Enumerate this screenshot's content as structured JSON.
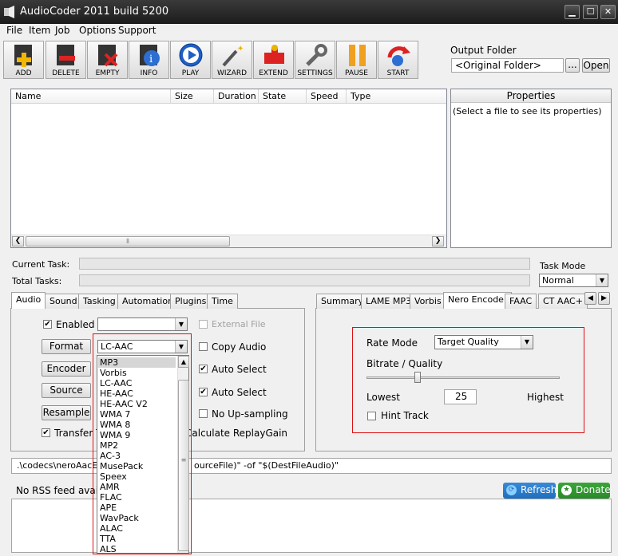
{
  "window": {
    "title": "AudioCoder 2011 build 5200",
    "minimize": "▁",
    "maximize": "☐",
    "close": "✕"
  },
  "menu": [
    "File",
    "Item",
    "Job",
    "Options",
    "Support"
  ],
  "toolbar": [
    {
      "label": "ADD",
      "icon": "add-icon"
    },
    {
      "label": "DELETE",
      "icon": "delete-icon"
    },
    {
      "label": "EMPTY",
      "icon": "empty-icon"
    },
    {
      "label": "INFO",
      "icon": "info-icon"
    },
    {
      "label": "PLAY",
      "icon": "play-icon"
    },
    {
      "label": "WIZARD",
      "icon": "wizard-icon"
    },
    {
      "label": "EXTEND",
      "icon": "extend-icon"
    },
    {
      "label": "SETTINGS",
      "icon": "settings-icon"
    },
    {
      "label": "PAUSE",
      "icon": "pause-icon"
    },
    {
      "label": "START",
      "icon": "start-icon"
    }
  ],
  "output": {
    "label": "Output Folder",
    "value": "<Original Folder>",
    "browse": "...",
    "open": "Open"
  },
  "filelist": {
    "columns": [
      "Name",
      "Size",
      "Duration",
      "State",
      "Speed",
      "Type"
    ]
  },
  "properties": {
    "header": "Properties",
    "placeholder": "(Select a file to see its properties)"
  },
  "progress": {
    "current_task": "Current Task:",
    "total_tasks": "Total Tasks:"
  },
  "task_mode": {
    "label": "Task Mode",
    "value": "Normal"
  },
  "left_tabs": [
    "Audio",
    "Sound",
    "Tasking",
    "Automation",
    "Plugins",
    "Time"
  ],
  "audio": {
    "enabled": "Enabled",
    "external_file": "External File",
    "format_btn": "Format",
    "format_value": "LC-AAC",
    "encoder_btn": "Encoder",
    "source_btn": "Source",
    "resample_btn": "Resample",
    "copy_audio": "Copy Audio",
    "auto_select_1": "Auto Select",
    "auto_select_2": "Auto Select",
    "no_upsampling": "No Up-sampling",
    "transfer_tags": "Transfer Ta",
    "replaygain": "Calculate ReplayGain"
  },
  "format_options": [
    "MP3",
    "Vorbis",
    "LC-AAC",
    "HE-AAC",
    "HE-AAC V2",
    "WMA 7",
    "WMA 8",
    "WMA 9",
    "MP2",
    "AC-3",
    "MusePack",
    "Speex",
    "AMR",
    "FLAC",
    "APE",
    "WavPack",
    "ALAC",
    "TTA",
    "ALS"
  ],
  "right_tabs": [
    "Summary",
    "LAME MP3",
    "Vorbis",
    "Nero Encoder",
    "FAAC",
    "CT AAC+"
  ],
  "nero": {
    "rate_mode_label": "Rate Mode",
    "rate_mode_value": "Target Quality",
    "bitrate_label": "Bitrate / Quality",
    "bitrate_level": 0.33,
    "lowest": "Lowest",
    "quality_value": "25",
    "highest": "Highest",
    "hint_track": "Hint Track"
  },
  "cmdline": {
    "part1": ".\\codecs\\neroAacEnc",
    "part2": "ourceFile)\" -of \"$(DestFileAudio)\""
  },
  "rss": {
    "status": "No RSS feed available",
    "refresh": "Refresh",
    "donate": "Donate"
  },
  "colors": {
    "accent_red": "#d11111",
    "refresh_blue": "#1e6fbd",
    "donate_green": "#2a8a2a"
  }
}
